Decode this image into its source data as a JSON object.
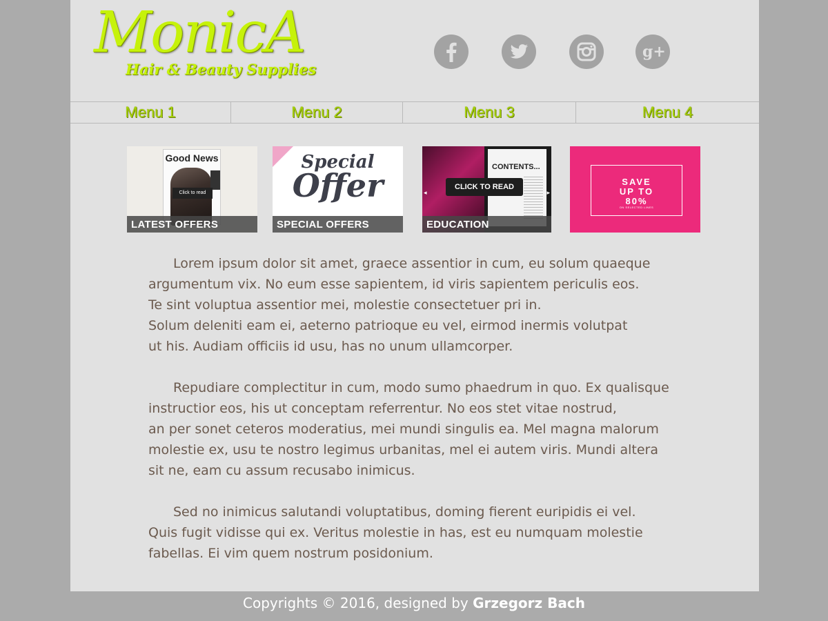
{
  "logo": {
    "title": "MonicA",
    "subtitle": "Hair & Beauty Supplies"
  },
  "social": [
    "facebook-icon",
    "twitter-icon",
    "instagram-icon",
    "google-plus-icon"
  ],
  "menu": [
    "Menu 1",
    "Menu 2",
    "Menu 3",
    "Menu 4"
  ],
  "tiles": [
    {
      "caption": "LATEST OFFERS",
      "magazine_title": "Good News",
      "overlay": "Click to read"
    },
    {
      "caption": "SPECIAL OFFERS",
      "line1": "Special",
      "line2": "Offer"
    },
    {
      "caption": "EDUCATION",
      "heading": "CONTENTS...",
      "overlay": "CLICK TO READ"
    },
    {
      "line1": "SAVE",
      "line2": "UP TO",
      "line3": "80%",
      "small": "ON SELECTED LINES"
    }
  ],
  "paragraphs": [
    [
      "Lorem ipsum dolor sit amet, graece assentior in cum, eu solum quaeque",
      "argumentum vix. No eum esse sapientem, id viris sapientem periculis eos.",
      "Te sint voluptua assentior mei, molestie consectetuer pri in.",
      "Solum deleniti eam ei, aeterno patrioque eu vel, eirmod inermis volutpat",
      "ut his. Audiam officiis id usu, has no unum ullamcorper."
    ],
    [
      "Repudiare complectitur in cum, modo sumo phaedrum in quo. Ex qualisque",
      "instructior eos, his ut conceptam referrentur. No eos stet vitae nostrud,",
      "an per sonet ceteros moderatius, mei mundi singulis ea. Mel magna malorum",
      "molestie ex, usu te nostro legimus urbanitas, mel ei autem viris. Mundi altera",
      "sit ne, eam cu assum recusabo inimicus."
    ],
    [
      "Sed no inimicus salutandi voluptatibus, doming fierent euripidis ei vel.",
      "Quis fugit vidisse qui ex. Veritus molestie in has, est eu numquam molestie",
      "fabellas. Ei vim quem nostrum posidonium."
    ]
  ],
  "footer": {
    "text": "Copyrights © 2016, designed by ",
    "author": "Grzegorz Bach"
  },
  "colors": {
    "accent": "#c6f20a",
    "page_bg": "#e1e1e1",
    "outer_bg": "#ababab",
    "promo_pink": "#ec2a7b",
    "text": "#6b5a4e"
  }
}
